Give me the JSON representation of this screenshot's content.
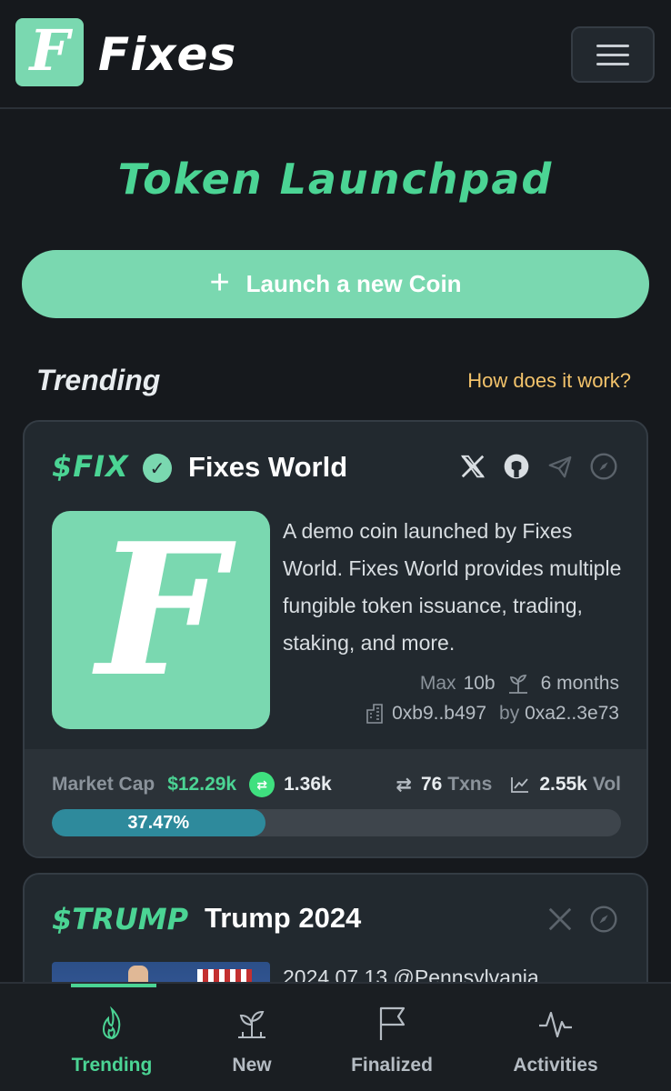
{
  "header": {
    "logo_letter": "F",
    "brand": "Fixes",
    "menu_icon": "hamburger-icon"
  },
  "page": {
    "title": "Token Launchpad",
    "launch_button": "Launch a new Coin",
    "launch_icon": "plus-icon"
  },
  "trending": {
    "title": "Trending",
    "help_link": "How does it work?"
  },
  "cards": [
    {
      "ticker": "$FIX",
      "verified_icon": "verified-badge-icon",
      "name": "Fixes World",
      "icons": [
        "x-icon",
        "github-icon",
        "telegram-icon",
        "compass-icon"
      ],
      "logo_letter": "F",
      "description": "A demo coin launched by Fixes World. Fixes World provides multiple fungible token issuance, trading, staking, and more.",
      "max_label": "Max",
      "max_value": "10b",
      "duration": "6 months",
      "contract": "0xb9..b497",
      "by_label": "by",
      "creator": "0xa2..3e73",
      "market_cap_label": "Market Cap",
      "market_cap_value": "$12.29k",
      "flow_value": "1.36k",
      "txns_value": "76",
      "txns_label": "Txns",
      "vol_value": "2.55k",
      "vol_label": "Vol",
      "progress_label": "37.47%",
      "progress_fraction": 0.3747
    },
    {
      "ticker": "$TRUMP",
      "name": "Trump 2024",
      "icons": [
        "x-icon",
        "compass-icon"
      ],
      "description": "2024.07.13 @Pennsylvania"
    }
  ],
  "bottom_nav": [
    {
      "label": "Trending",
      "icon": "flame-icon",
      "active": true
    },
    {
      "label": "New",
      "icon": "sprout-icon",
      "active": false
    },
    {
      "label": "Finalized",
      "icon": "flag-icon",
      "active": false
    },
    {
      "label": "Activities",
      "icon": "activity-icon",
      "active": false
    }
  ],
  "colors": {
    "background": "#16191d",
    "accent": "#7ad8b0",
    "accent_text": "#4bd494",
    "link": "#f3c36b",
    "progress": "#2e8a9c"
  }
}
